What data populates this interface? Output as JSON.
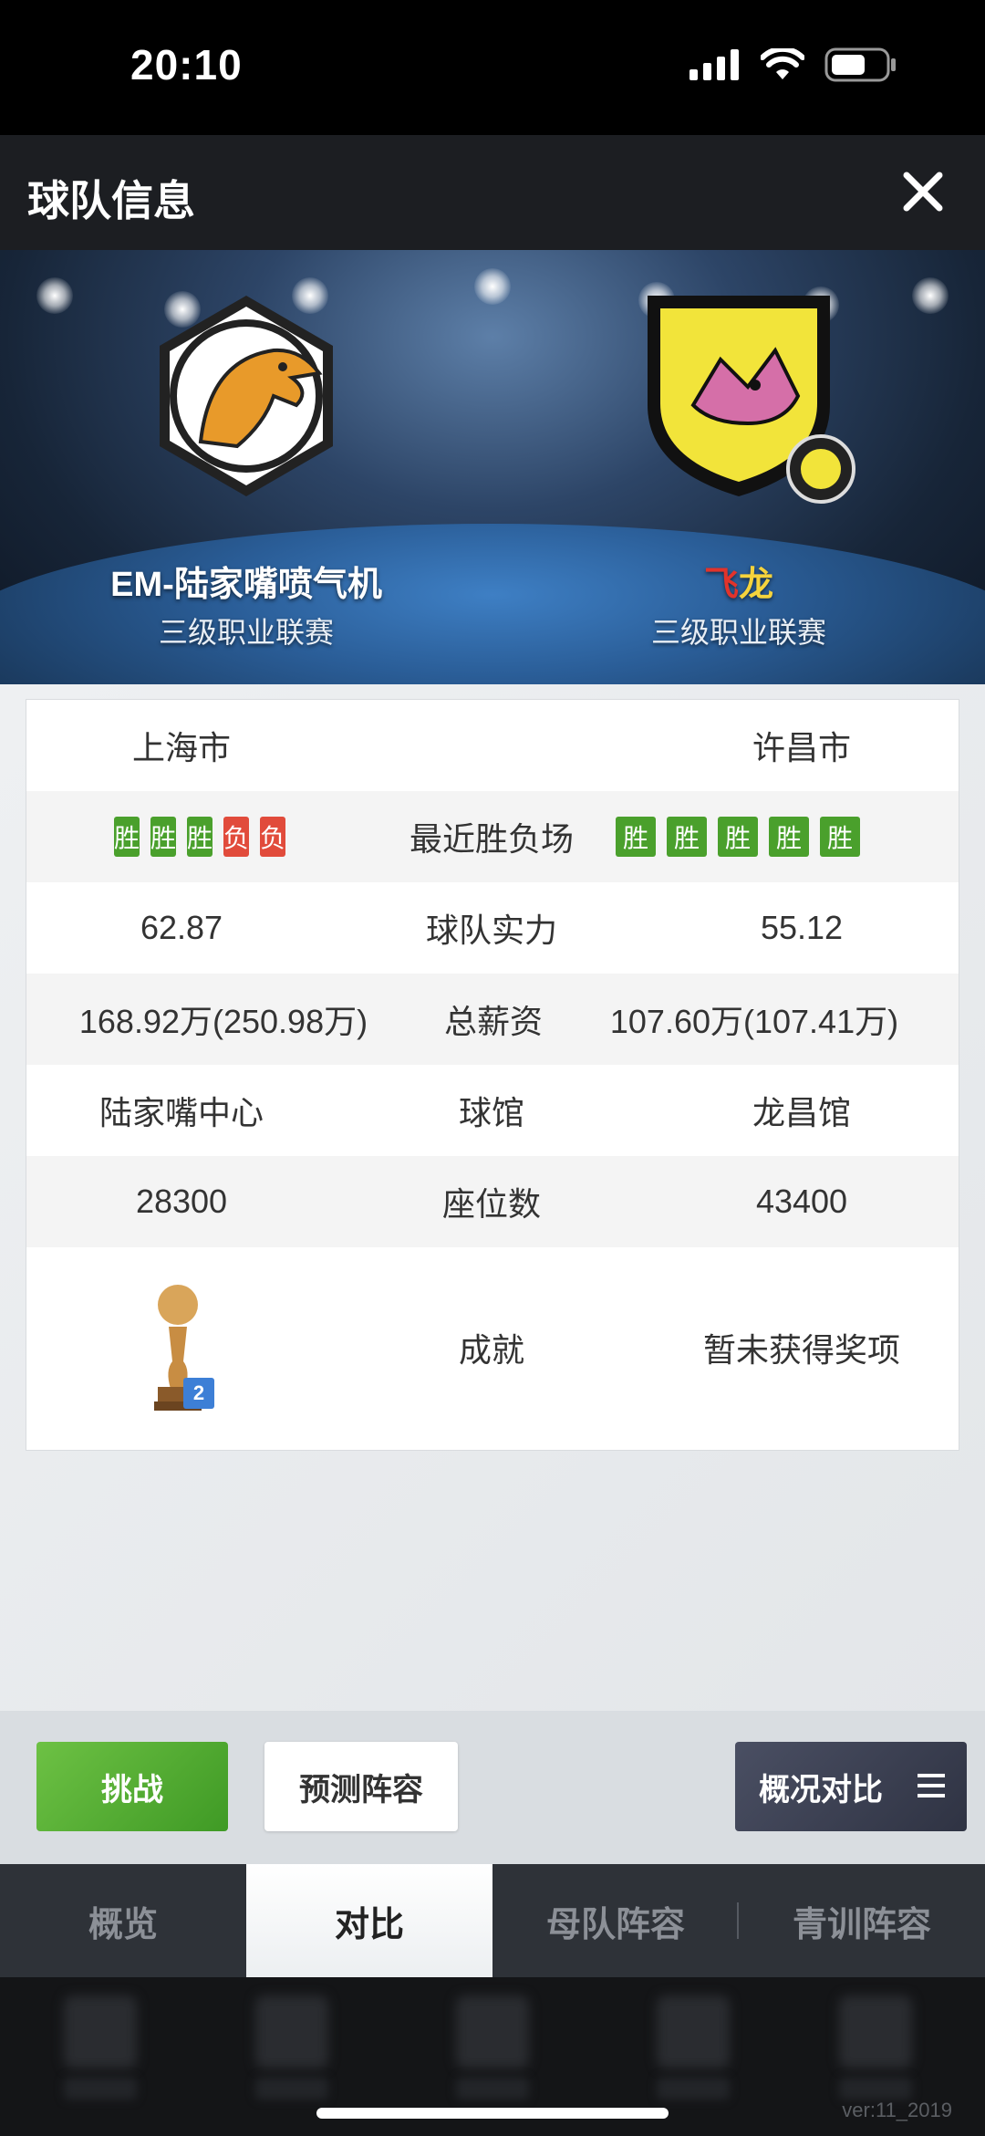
{
  "status_bar": {
    "time": "20:10"
  },
  "header": {
    "title": "球队信息"
  },
  "teams": {
    "home": {
      "name": "EM-陆家嘴喷气机",
      "league": "三级职业联赛"
    },
    "away": {
      "name_part1": "飞",
      "name_part2": "龙",
      "league": "三级职业联赛"
    }
  },
  "comparison": {
    "city": {
      "home": "上海市",
      "away": "许昌市"
    },
    "recent": {
      "label": "最近胜负场",
      "home": [
        "胜",
        "胜",
        "胜",
        "负",
        "负"
      ],
      "away": [
        "胜",
        "胜",
        "胜",
        "胜",
        "胜"
      ]
    },
    "strength": {
      "label": "球队实力",
      "home": "62.87",
      "away": "55.12"
    },
    "salary": {
      "label": "总薪资",
      "home": "168.92万(250.98万)",
      "away": "107.60万(107.41万)"
    },
    "arena": {
      "label": "球馆",
      "home": "陆家嘴中心",
      "away": "龙昌馆"
    },
    "seats": {
      "label": "座位数",
      "home": "28300",
      "away": "43400"
    },
    "achievements": {
      "label": "成就",
      "home_trophy_count": "2",
      "away": "暂未获得奖项"
    }
  },
  "actions": {
    "challenge": "挑战",
    "predict": "预测阵容",
    "compare_menu": "概况对比"
  },
  "tabs": [
    "概览",
    "对比",
    "母队阵容",
    "青训阵容"
  ],
  "active_tab": "对比",
  "version": "ver:11_2019",
  "colors": {
    "win": "#4aa02c",
    "loss": "#e14b3b",
    "away_name_red": "#e2332b",
    "away_name_yellow": "#f5d33c"
  }
}
